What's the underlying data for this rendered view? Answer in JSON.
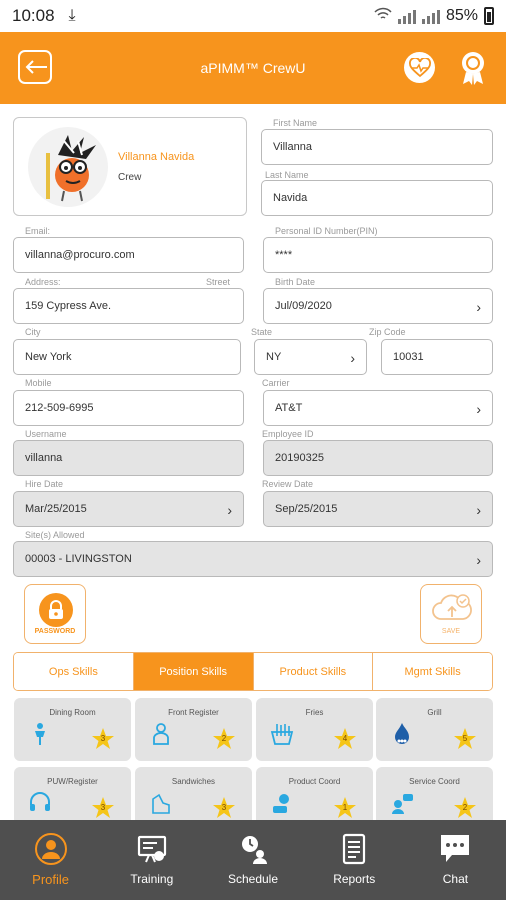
{
  "status_bar": {
    "time": "10:08",
    "battery": "85%"
  },
  "app_bar": {
    "title": "aPIMM™ CrewU"
  },
  "profile": {
    "name": "Villanna Navida",
    "role": "Crew"
  },
  "fields": {
    "first_name": {
      "label": "First Name",
      "value": "Villanna"
    },
    "last_name": {
      "label": "Last Name",
      "value": "Navida"
    },
    "email": {
      "label": "Email:",
      "value": "villanna@procuro.com"
    },
    "pin": {
      "label": "Personal ID Number(PIN)",
      "value": "****"
    },
    "address": {
      "label": "Address:",
      "sublabel": "Street",
      "value": "159 Cypress Ave."
    },
    "birth_date": {
      "label": "Birth Date",
      "value": "Jul/09/2020"
    },
    "city": {
      "label": "City",
      "value": "New York"
    },
    "state": {
      "label": "State",
      "value": "NY"
    },
    "zip": {
      "label": "Zip Code",
      "value": "10031"
    },
    "mobile": {
      "label": "Mobile",
      "value": "212-509-6995"
    },
    "carrier": {
      "label": "Carrier",
      "value": "AT&T"
    },
    "username": {
      "label": "Username",
      "value": "villanna"
    },
    "employee_id": {
      "label": "Employee ID",
      "value": "20190325"
    },
    "hire_date": {
      "label": "Hire Date",
      "value": "Mar/25/2015"
    },
    "review_date": {
      "label": "Review Date",
      "value": "Sep/25/2015"
    },
    "sites": {
      "label": "Site(s) Allowed",
      "value": "00003 - LIVINGSTON"
    }
  },
  "actions": {
    "password_label": "PASSWORD",
    "save_label": "SAVE"
  },
  "tabs": [
    {
      "label": "Ops Skills"
    },
    {
      "label": "Position Skills"
    },
    {
      "label": "Product Skills"
    },
    {
      "label": "Mgmt Skills"
    }
  ],
  "skills": [
    {
      "name": "Dining Room",
      "level": "3",
      "icon": "person-icon"
    },
    {
      "name": "Front Register",
      "level": "2",
      "icon": "cashier-icon"
    },
    {
      "name": "Fries",
      "level": "4",
      "icon": "fries-icon"
    },
    {
      "name": "Grill",
      "level": "5",
      "icon": "flame-icon"
    },
    {
      "name": "PUW/Register",
      "level": "3",
      "icon": "headset-icon"
    },
    {
      "name": "Sandwiches",
      "level": "3",
      "icon": "sandwich-icon"
    },
    {
      "name": "Product Coord",
      "level": "1",
      "icon": "coord-icon"
    },
    {
      "name": "Service Coord",
      "level": "2",
      "icon": "service-icon"
    }
  ],
  "bottom_nav": [
    {
      "label": "Profile",
      "icon": "profile-icon"
    },
    {
      "label": "Training",
      "icon": "training-icon"
    },
    {
      "label": "Schedule",
      "icon": "schedule-icon"
    },
    {
      "label": "Reports",
      "icon": "reports-icon"
    },
    {
      "label": "Chat",
      "icon": "chat-icon"
    }
  ],
  "colors": {
    "accent": "#f7941d",
    "nav_bg": "#4f4f4f",
    "skill_bg": "#e3e3e3",
    "icon_blue": "#2aa8e0",
    "star": "#f5c518"
  }
}
